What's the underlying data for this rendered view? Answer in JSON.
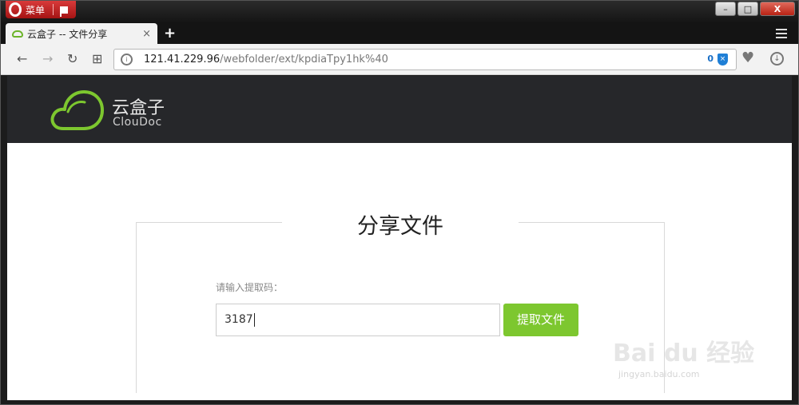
{
  "browser": {
    "menu_label": "菜单",
    "tab_title": "云盒子 -- 文件分享",
    "tab_close": "×",
    "new_tab": "+",
    "url_host": "121.41.229.96",
    "url_path": "/webfolder/ext/kpdiaTpy1hk%40",
    "adblock_count": "0",
    "window_controls": {
      "minimize": "–",
      "maximize": "□",
      "close": "X"
    },
    "nav": {
      "back": "←",
      "forward": "→",
      "reload": "↻",
      "speed_dial": "⊞",
      "heart": "♥",
      "download": "↓"
    }
  },
  "site": {
    "logo_cn": "云盒子",
    "logo_en": "ClouDoc",
    "brand_color": "#7dc72f"
  },
  "share": {
    "title": "分享文件",
    "prompt": "请输入提取码：",
    "code_value": "3187",
    "submit_label": "提取文件"
  },
  "watermark": {
    "line1": "Bai du 经验",
    "line2": "jingyan.baidu.com"
  }
}
